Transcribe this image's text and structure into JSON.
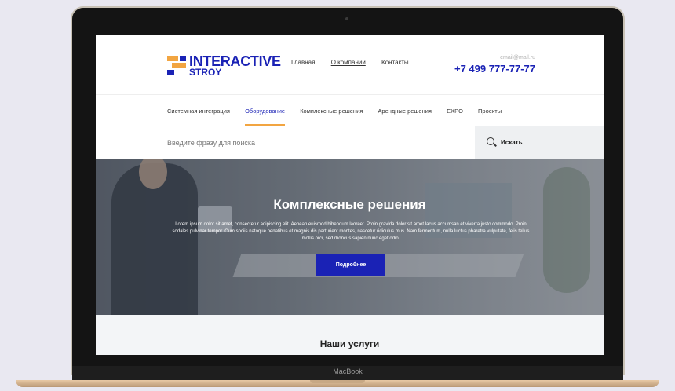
{
  "device": {
    "brand": "MacBook"
  },
  "header": {
    "logo_title": "INTERACTIVE",
    "logo_sub": "STROY",
    "nav": [
      "Главная",
      "О компании",
      "Контакты"
    ],
    "email": "email@mail.ru",
    "phone": "+7 499 777-77-77"
  },
  "catnav": [
    "Системная интеграция",
    "Оборудование",
    "Комплексные решения",
    "Арендные решения",
    "EXPO",
    "Проекты"
  ],
  "search": {
    "placeholder": "Введите фразу для поиска",
    "button": "Искать"
  },
  "hero": {
    "title": "Комплексные решения",
    "text": "Lorem ipsum dolor sit amet, consectetur adipiscing elit. Aenean euismod bibendum laoreet. Proin gravida dolor sit amet lacus accumsan et viverra justo commodo. Proin sodales pulvinar tempor. Cum sociis natoque penatibus et magnis dis parturient montes, nascetur ridiculus mus. Nam fermentum, nulla luctus pharetra vulputate, felis tellus mollis orci, sed rhoncus sapien nunc eget odio.",
    "button": "Подробнее"
  },
  "services": {
    "title": "Наши услуги"
  },
  "colors": {
    "brand": "#1a22b5",
    "accent": "#f2a541"
  }
}
